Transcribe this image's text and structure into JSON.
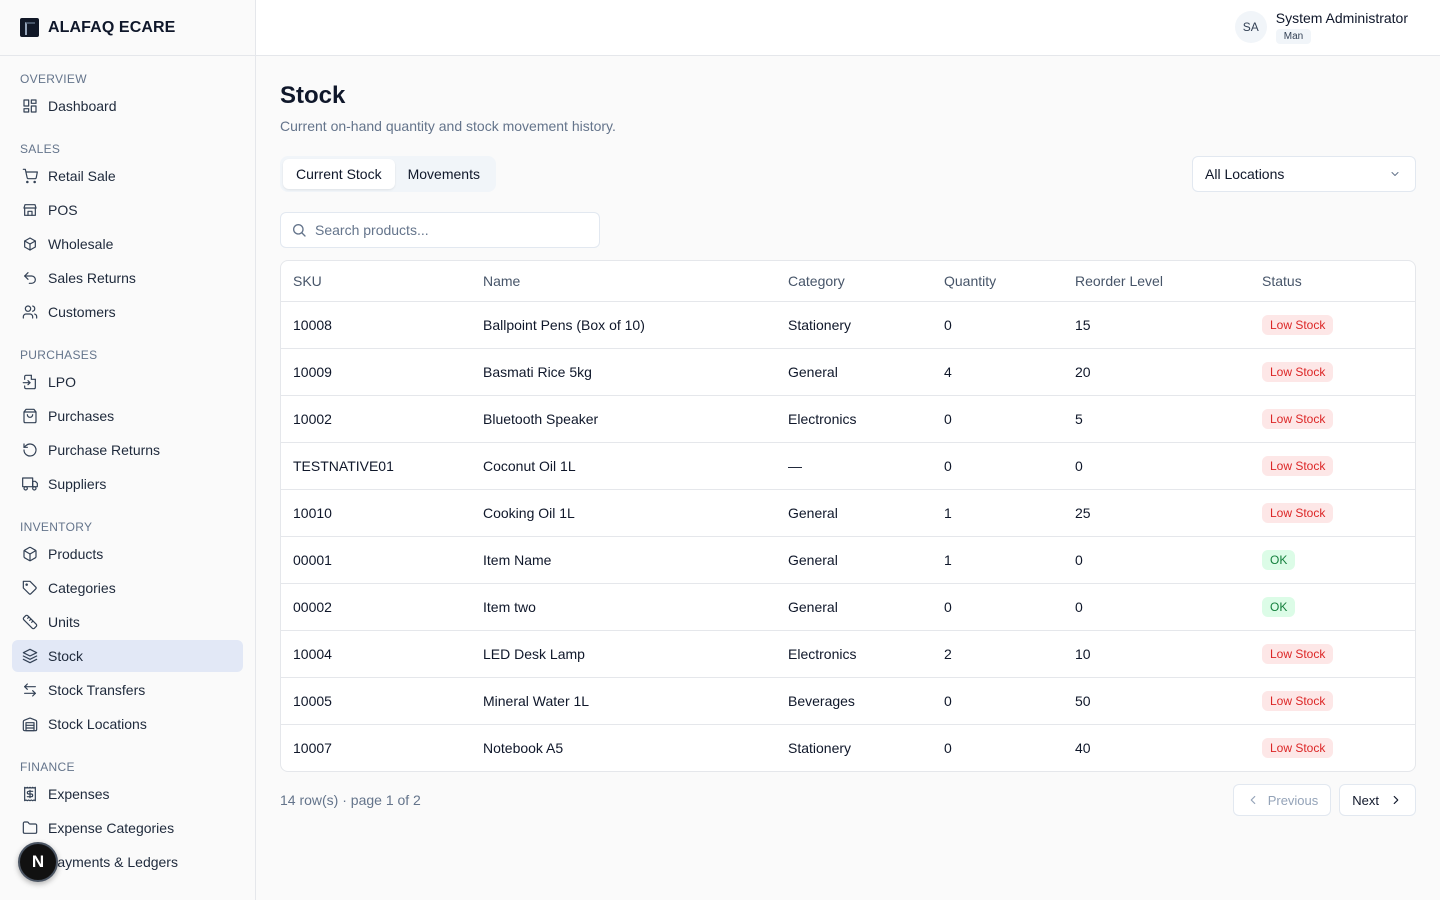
{
  "brand": {
    "name": "ALAFAQ ECARE"
  },
  "user": {
    "initials": "SA",
    "name": "System Administrator",
    "role": "Man"
  },
  "sidebar": {
    "sections": [
      {
        "title": "OVERVIEW",
        "items": [
          {
            "label": "Dashboard",
            "icon": "dashboard-icon"
          }
        ]
      },
      {
        "title": "SALES",
        "items": [
          {
            "label": "Retail Sale",
            "icon": "cart-icon"
          },
          {
            "label": "POS",
            "icon": "store-icon"
          },
          {
            "label": "Wholesale",
            "icon": "boxes-icon"
          },
          {
            "label": "Sales Returns",
            "icon": "undo-icon"
          },
          {
            "label": "Customers",
            "icon": "users-icon"
          }
        ]
      },
      {
        "title": "PURCHASES",
        "items": [
          {
            "label": "LPO",
            "icon": "file-import-icon"
          },
          {
            "label": "Purchases",
            "icon": "shopping-bag-icon"
          },
          {
            "label": "Purchase Returns",
            "icon": "rotate-icon"
          },
          {
            "label": "Suppliers",
            "icon": "truck-icon"
          }
        ]
      },
      {
        "title": "INVENTORY",
        "items": [
          {
            "label": "Products",
            "icon": "package-icon"
          },
          {
            "label": "Categories",
            "icon": "tag-icon"
          },
          {
            "label": "Units",
            "icon": "ruler-icon"
          },
          {
            "label": "Stock",
            "icon": "layers-icon",
            "active": true
          },
          {
            "label": "Stock Transfers",
            "icon": "transfer-icon"
          },
          {
            "label": "Stock Locations",
            "icon": "warehouse-icon"
          }
        ]
      },
      {
        "title": "FINANCE",
        "items": [
          {
            "label": "Expenses",
            "icon": "receipt-icon"
          },
          {
            "label": "Expense Categories",
            "icon": "folder-icon"
          },
          {
            "label": "Payments & Ledgers",
            "icon": "wallet-icon"
          }
        ]
      }
    ]
  },
  "page": {
    "title": "Stock",
    "subtitle": "Current on-hand quantity and stock movement history.",
    "tabs": [
      "Current Stock",
      "Movements"
    ],
    "active_tab": "Current Stock",
    "location_select": "All Locations",
    "search_placeholder": "Search products..."
  },
  "table": {
    "columns": [
      "SKU",
      "Name",
      "Category",
      "Quantity",
      "Reorder Level",
      "Status"
    ],
    "rows": [
      {
        "sku": "10008",
        "name": "Ballpoint Pens (Box of 10)",
        "category": "Stationery",
        "quantity": "0",
        "reorder": "15",
        "status": "Low Stock"
      },
      {
        "sku": "10009",
        "name": "Basmati Rice 5kg",
        "category": "General",
        "quantity": "4",
        "reorder": "20",
        "status": "Low Stock"
      },
      {
        "sku": "10002",
        "name": "Bluetooth Speaker",
        "category": "Electronics",
        "quantity": "0",
        "reorder": "5",
        "status": "Low Stock"
      },
      {
        "sku": "TESTNATIVE01",
        "name": "Coconut Oil 1L",
        "category": "—",
        "quantity": "0",
        "reorder": "0",
        "status": "Low Stock"
      },
      {
        "sku": "10010",
        "name": "Cooking Oil 1L",
        "category": "General",
        "quantity": "1",
        "reorder": "25",
        "status": "Low Stock"
      },
      {
        "sku": "00001",
        "name": "Item Name",
        "category": "General",
        "quantity": "1",
        "reorder": "0",
        "status": "OK"
      },
      {
        "sku": "00002",
        "name": "Item two",
        "category": "General",
        "quantity": "0",
        "reorder": "0",
        "status": "OK"
      },
      {
        "sku": "10004",
        "name": "LED Desk Lamp",
        "category": "Electronics",
        "quantity": "2",
        "reorder": "10",
        "status": "Low Stock"
      },
      {
        "sku": "10005",
        "name": "Mineral Water 1L",
        "category": "Beverages",
        "quantity": "0",
        "reorder": "50",
        "status": "Low Stock"
      },
      {
        "sku": "10007",
        "name": "Notebook A5",
        "category": "Stationery",
        "quantity": "0",
        "reorder": "40",
        "status": "Low Stock"
      }
    ]
  },
  "pagination": {
    "info": "14 row(s) · page 1 of 2",
    "prev_label": "Previous",
    "next_label": "Next"
  },
  "fab": {
    "label": "N"
  },
  "colors": {
    "low_stock_bg": "#fde7e7",
    "low_stock_text": "#dc2626",
    "ok_bg": "#dcfce7",
    "ok_text": "#15803d",
    "active_nav_bg": "#e2e8f6"
  }
}
